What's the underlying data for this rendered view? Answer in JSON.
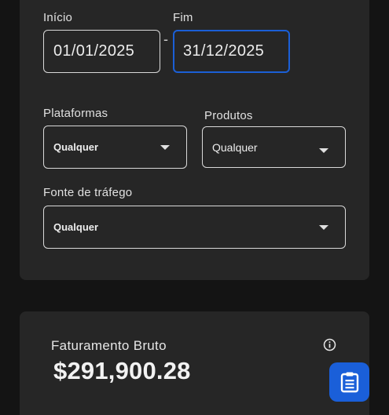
{
  "filters": {
    "start": {
      "label": "Início",
      "value": "01/01/2025"
    },
    "separator": "-",
    "end": {
      "label": "Fim",
      "value": "31/12/2025"
    },
    "platforms": {
      "label": "Plataformas",
      "value": "Qualquer"
    },
    "products": {
      "label": "Produtos",
      "value": "Qualquer"
    },
    "traffic_source": {
      "label": "Fonte de tráfego",
      "value": "Qualquer"
    }
  },
  "revenue": {
    "title": "Faturamento Bruto",
    "value": "$291,900.28"
  },
  "icons": {
    "info": "info-circle-icon",
    "report": "clipboard-list-icon"
  },
  "colors": {
    "accent": "#1a5fd9",
    "card": "#262626",
    "background": "#141414"
  }
}
